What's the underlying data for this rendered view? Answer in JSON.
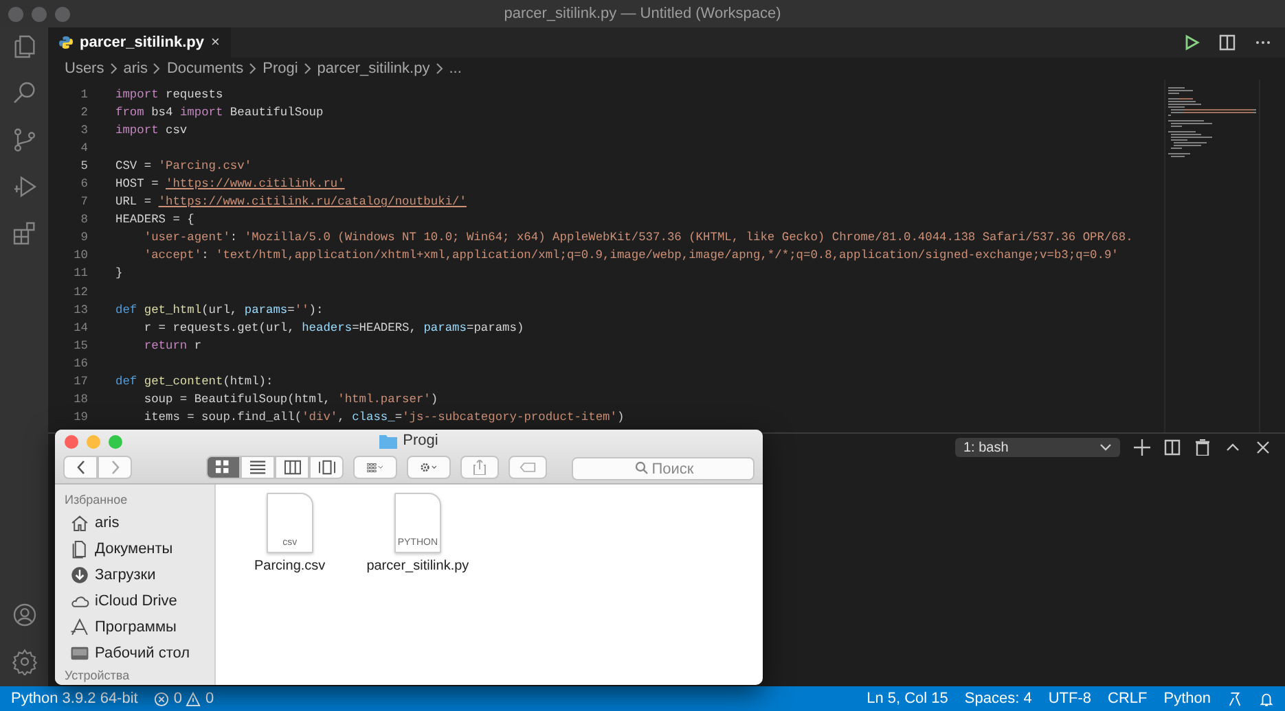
{
  "window": {
    "title": "parcer_sitilink.py — Untitled (Workspace)"
  },
  "tabs": [
    {
      "label": "parcer_sitilink.py",
      "selected": true,
      "close": "×"
    }
  ],
  "breadcrumb": [
    "Users",
    "aris",
    "Documents",
    "Progi",
    "parcer_sitilink.py",
    "..."
  ],
  "editor": {
    "lines": [
      {
        "number": "1",
        "active": false,
        "code": [
          {
            "kind": "keyword",
            "text": "import"
          },
          {
            "kind": "plain",
            "text": " requests"
          }
        ]
      },
      {
        "number": "2",
        "active": false,
        "code": [
          {
            "kind": "keyword",
            "text": "from"
          },
          {
            "kind": "plain",
            "text": " bs4 "
          },
          {
            "kind": "keyword",
            "text": "import"
          },
          {
            "kind": "plain",
            "text": " BeautifulSoup"
          }
        ]
      },
      {
        "number": "3",
        "active": false,
        "code": [
          {
            "kind": "keyword",
            "text": "import"
          },
          {
            "kind": "plain",
            "text": " csv"
          }
        ]
      },
      {
        "number": "4",
        "active": false
      },
      {
        "number": "5",
        "active": true,
        "code": [
          {
            "kind": "plain",
            "text": "CSV = "
          },
          {
            "kind": "string",
            "text": "'Parcing.csv'"
          }
        ]
      },
      {
        "number": "6",
        "active": false,
        "code": [
          {
            "kind": "plain",
            "text": "HOST = "
          },
          {
            "kind": "link",
            "text": "'https://www.citilink.ru'"
          }
        ]
      },
      {
        "number": "7",
        "active": false,
        "code": [
          {
            "kind": "plain",
            "text": "URL = "
          },
          {
            "kind": "link",
            "text": "'https://www.citilink.ru/catalog/noutbuki/'"
          }
        ]
      },
      {
        "number": "8",
        "active": false,
        "code": [
          {
            "kind": "plain",
            "text": "HEADERS = {"
          }
        ]
      },
      {
        "number": "9",
        "active": false,
        "code": [
          {
            "kind": "string",
            "text": "    'user-agent'"
          },
          {
            "kind": "plain",
            "text": ": "
          },
          {
            "kind": "string",
            "text": "'Mozilla/5.0 (Windows NT 10.0; Win64; x64) AppleWebKit/537.36 (KHTML, like Gecko) Chrome/81.0.4044.138 Safari/537.36 OPR/68."
          }
        ]
      },
      {
        "number": "10",
        "active": false,
        "code": [
          {
            "kind": "string",
            "text": "    'accept'"
          },
          {
            "kind": "plain",
            "text": ": "
          },
          {
            "kind": "string",
            "text": "'text/html,application/xhtml+xml,application/xml;q=0.9,image/webp,image/apng,*/*;q=0.8,application/signed-exchange;v=b3;q=0.9'"
          }
        ]
      },
      {
        "number": "11",
        "active": false,
        "code": [
          {
            "kind": "plain",
            "text": "}"
          }
        ]
      },
      {
        "number": "12",
        "active": false
      },
      {
        "number": "13",
        "active": false,
        "code": [
          {
            "kind": "storage",
            "text": "def "
          },
          {
            "kind": "function",
            "text": "get_html"
          },
          {
            "kind": "plain",
            "text": "(url, "
          },
          {
            "kind": "param",
            "text": "params"
          },
          {
            "kind": "plain",
            "text": "="
          },
          {
            "kind": "string",
            "text": "''"
          },
          {
            "kind": "plain",
            "text": "):"
          }
        ]
      },
      {
        "number": "14",
        "active": false,
        "code": [
          {
            "kind": "plain",
            "text": "    r = requests.get(url, "
          },
          {
            "kind": "param",
            "text": "headers"
          },
          {
            "kind": "plain",
            "text": "=HEADERS, "
          },
          {
            "kind": "param",
            "text": "params"
          },
          {
            "kind": "plain",
            "text": "=params)"
          }
        ]
      },
      {
        "number": "15",
        "active": false,
        "code": [
          {
            "kind": "keyword",
            "text": "    return"
          },
          {
            "kind": "plain",
            "text": " r"
          }
        ]
      },
      {
        "number": "16",
        "active": false
      },
      {
        "number": "17",
        "active": false,
        "code": [
          {
            "kind": "storage",
            "text": "def "
          },
          {
            "kind": "function",
            "text": "get_content"
          },
          {
            "kind": "plain",
            "text": "(html):"
          }
        ]
      },
      {
        "number": "18",
        "active": false,
        "code": [
          {
            "kind": "plain",
            "text": "    soup = BeautifulSoup(html, "
          },
          {
            "kind": "string",
            "text": "'html.parser'"
          },
          {
            "kind": "plain",
            "text": ")"
          }
        ]
      },
      {
        "number": "19",
        "active": false,
        "code": [
          {
            "kind": "plain",
            "text": "    items = soup.find_all("
          },
          {
            "kind": "string",
            "text": "'div'"
          },
          {
            "kind": "plain",
            "text": ", "
          },
          {
            "kind": "param",
            "text": "class_"
          },
          {
            "kind": "plain",
            "text": "="
          },
          {
            "kind": "string",
            "text": "'js--subcategory-product-item'"
          },
          {
            "kind": "plain",
            "text": ")"
          }
        ]
      }
    ]
  },
  "terminal": {
    "selector": "1: bash"
  },
  "finder": {
    "title": "Progi",
    "search": {
      "placeholder": "Поиск"
    },
    "view_modes": [
      {
        "kind": "icons",
        "selected": true
      },
      {
        "kind": "list",
        "selected": false
      },
      {
        "kind": "columns",
        "selected": false
      },
      {
        "kind": "gallery",
        "selected": false
      }
    ],
    "sidebar": [
      {
        "heading": "Избранное",
        "items": [
          {
            "kind": "home",
            "label": "aris"
          },
          {
            "kind": "documents",
            "label": "Документы"
          },
          {
            "kind": "downloads",
            "label": "Загрузки"
          },
          {
            "kind": "cloud",
            "label": "iCloud Drive"
          },
          {
            "kind": "apps",
            "label": "Программы"
          },
          {
            "kind": "desktop",
            "label": "Рабочий стол"
          }
        ]
      },
      {
        "heading": "Устройства"
      }
    ],
    "files": [
      {
        "name": "Parcing.csv",
        "badge": "csv"
      },
      {
        "name": "parcer_sitilink.py",
        "badge": "PYTHON"
      }
    ]
  },
  "status_bar": {
    "interpreter": "Python 3.9.2 64-bit",
    "errors": "0",
    "warnings": "0",
    "right": [
      "Ln 5, Col 15",
      "Spaces: 4",
      "UTF-8",
      "CRLF",
      "Python"
    ]
  }
}
